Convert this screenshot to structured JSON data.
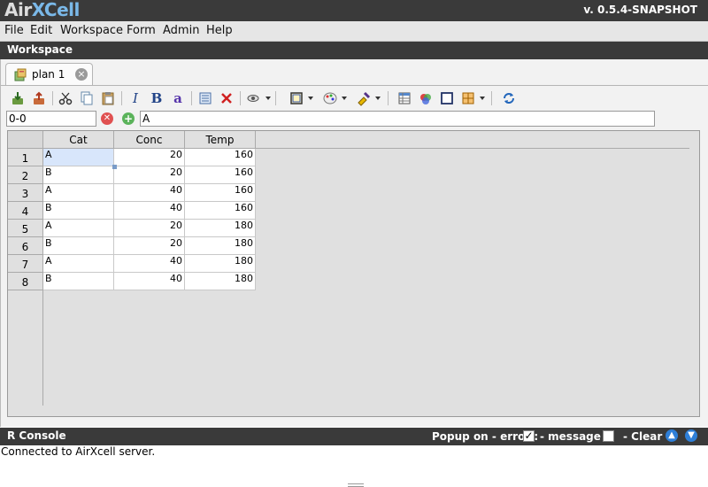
{
  "app": {
    "logo_part1": "Air",
    "logo_part2": "XCell",
    "version": "v. 0.5.4-SNAPSHOT"
  },
  "menu": [
    "File",
    "Edit",
    "Workspace",
    "Form",
    "Admin",
    "Help"
  ],
  "workspace": {
    "title": "Workspace"
  },
  "tab": {
    "label": "plan 1",
    "close_icon": "close-icon"
  },
  "toolbar": {
    "icons": [
      "import-icon",
      "export-icon",
      "cut-icon",
      "copy-icon",
      "paste-icon",
      "italic-icon",
      "bold-icon",
      "font-color-icon",
      "list-icon",
      "delete-icon",
      "view-icon",
      "border-icon",
      "color-palette-icon",
      "fill-color-icon",
      "table-icon",
      "chart-icon",
      "frame-icon",
      "grid-layout-icon",
      "refresh-icon"
    ],
    "italic": "I",
    "bold": "B",
    "font_color": "a"
  },
  "cellbar": {
    "cell_ref": "0-0",
    "formula": "A"
  },
  "grid": {
    "columns": [
      "Cat",
      "Conc",
      "Temp"
    ],
    "row_numbers": [
      "1",
      "2",
      "3",
      "4",
      "5",
      "6",
      "7",
      "8"
    ],
    "rows": [
      [
        "A",
        "20",
        "160"
      ],
      [
        "B",
        "20",
        "160"
      ],
      [
        "A",
        "40",
        "160"
      ],
      [
        "B",
        "40",
        "160"
      ],
      [
        "A",
        "20",
        "180"
      ],
      [
        "B",
        "20",
        "180"
      ],
      [
        "A",
        "40",
        "180"
      ],
      [
        "B",
        "40",
        "180"
      ]
    ],
    "selected_cell": "1-Cat"
  },
  "console": {
    "title": "R Console",
    "popup_error_label": "Popup on - error :",
    "popup_error_checked": true,
    "popup_message_label": "- message :",
    "popup_message_checked": false,
    "clear_label": "- Clear"
  },
  "status": {
    "text": "Connected to AirXcell server."
  },
  "colors": {
    "header_dark": "#3a3a3a",
    "logo_blue": "#7ab8e8",
    "selection": "#d8e6fb"
  }
}
